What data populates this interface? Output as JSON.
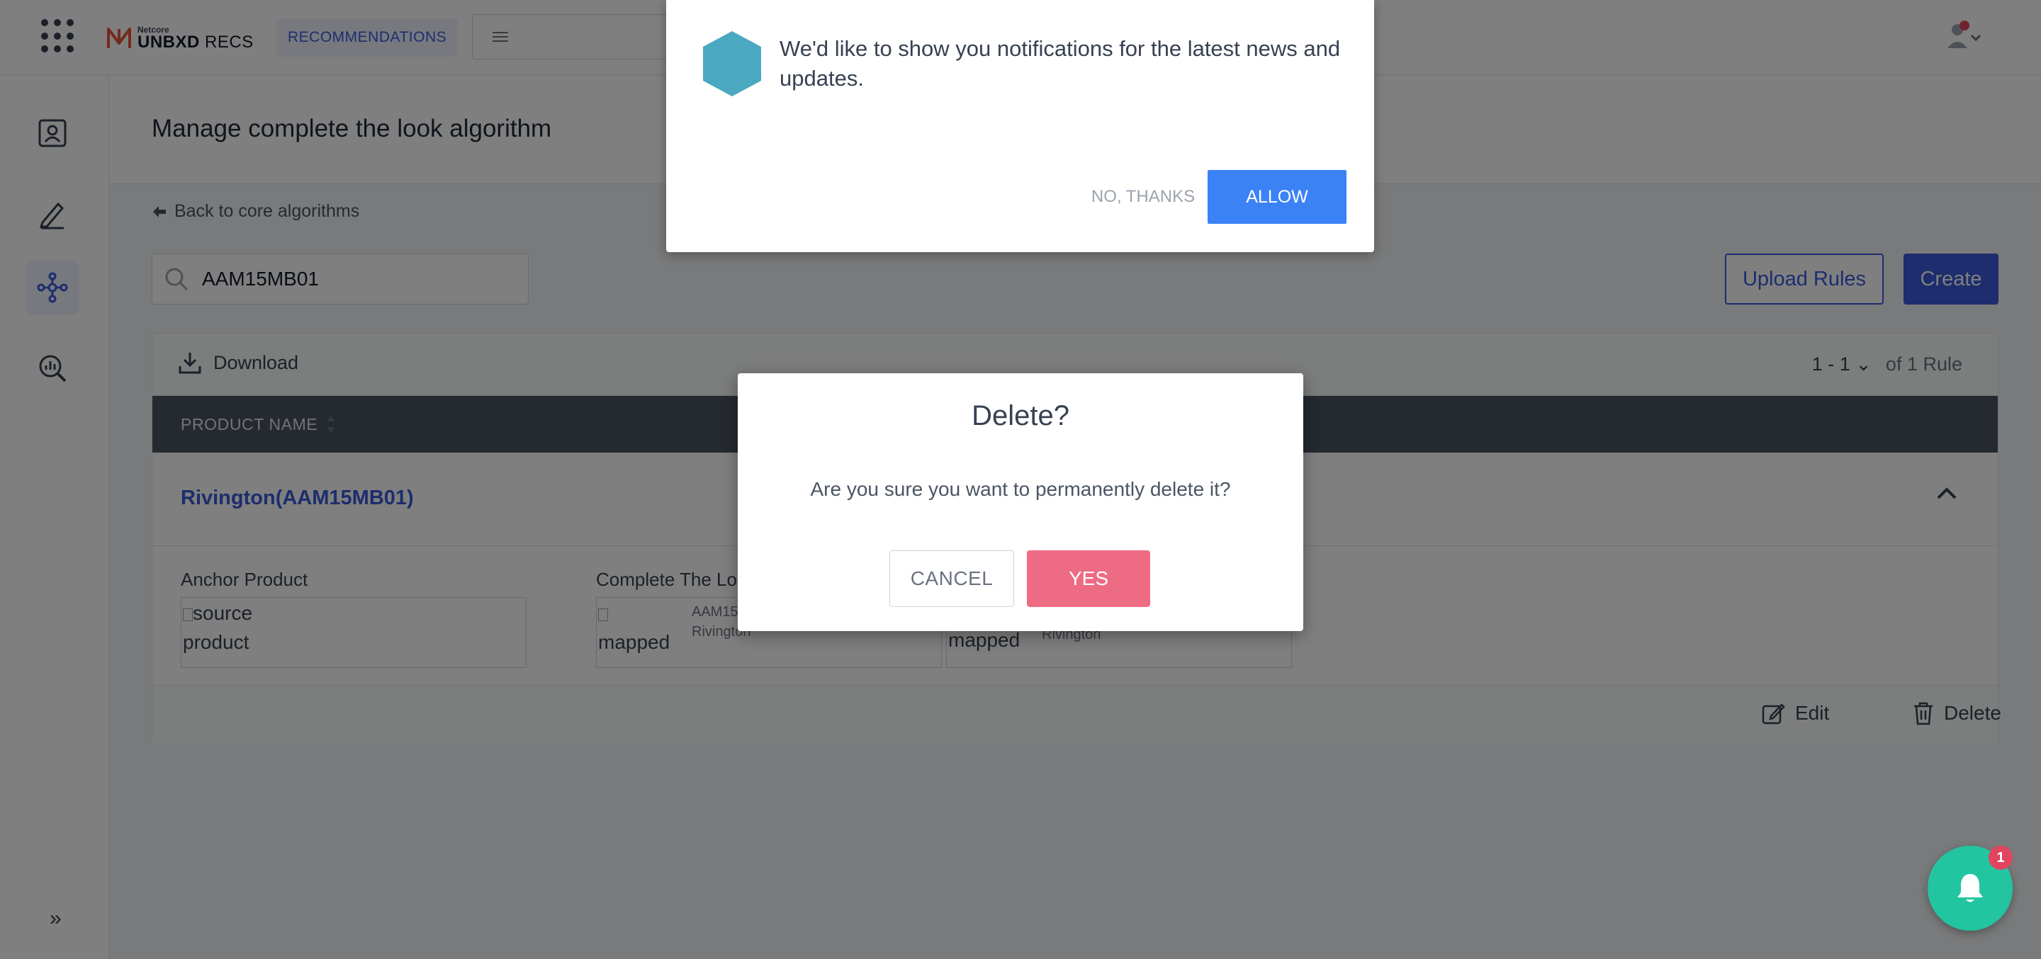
{
  "header": {
    "brand_small": "Netcore",
    "brand_main": "UNBXD",
    "brand_suffix": "RECS",
    "active_tab": "RECOMMENDATIONS"
  },
  "page": {
    "title": "Manage complete the look algorithm",
    "back_link": "Back to core algorithms"
  },
  "search": {
    "value": "AAM15MB01"
  },
  "actions": {
    "upload": "Upload Rules",
    "create": "Create"
  },
  "table": {
    "download": "Download",
    "pager_range": "1 - 1",
    "pager_total": "of 1 Rule",
    "column_product": "PRODUCT NAME",
    "product_name": "Rivington(AAM15MB01)",
    "anchor_label": "Anchor Product",
    "anchor_alt_1": "source",
    "anchor_alt_2": "product",
    "ctl_label": "Complete The Lo",
    "mapped_alt": "mapped",
    "mapped_code": "AAM15",
    "mapped_name": "Rivington",
    "mapped2_name": "Rivington",
    "edit": "Edit",
    "delete": "Delete"
  },
  "notification": {
    "message": "We'd like to show you notifications for the latest news and updates.",
    "no_thanks": "NO, THANKS",
    "allow": "ALLOW"
  },
  "dialog": {
    "title": "Delete?",
    "message": "Are you sure you want to permanently delete it?",
    "cancel": "CANCEL",
    "yes": "YES"
  },
  "bell": {
    "badge": "1"
  },
  "colors": {
    "accent": "#3b5bdb",
    "danger": "#ee6b84",
    "allow": "#3b82f6",
    "bell": "#22c5a0"
  }
}
